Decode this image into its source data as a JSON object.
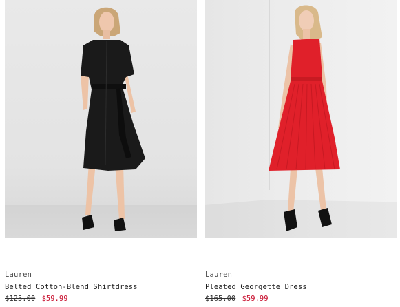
{
  "products": [
    {
      "brand": "Lauren",
      "name": "Belted Cotton-Blend Shirtdress",
      "original_price": "$125.00",
      "sale_price": "$59.99",
      "dress_color": "#1a1a1a"
    },
    {
      "brand": "Lauren",
      "name": "Pleated Georgette Dress",
      "original_price": "$165.00",
      "sale_price": "$59.99",
      "dress_color": "#e0202a"
    }
  ],
  "colors": {
    "sale_price": "#c8102e",
    "text": "#1c1c1c"
  }
}
